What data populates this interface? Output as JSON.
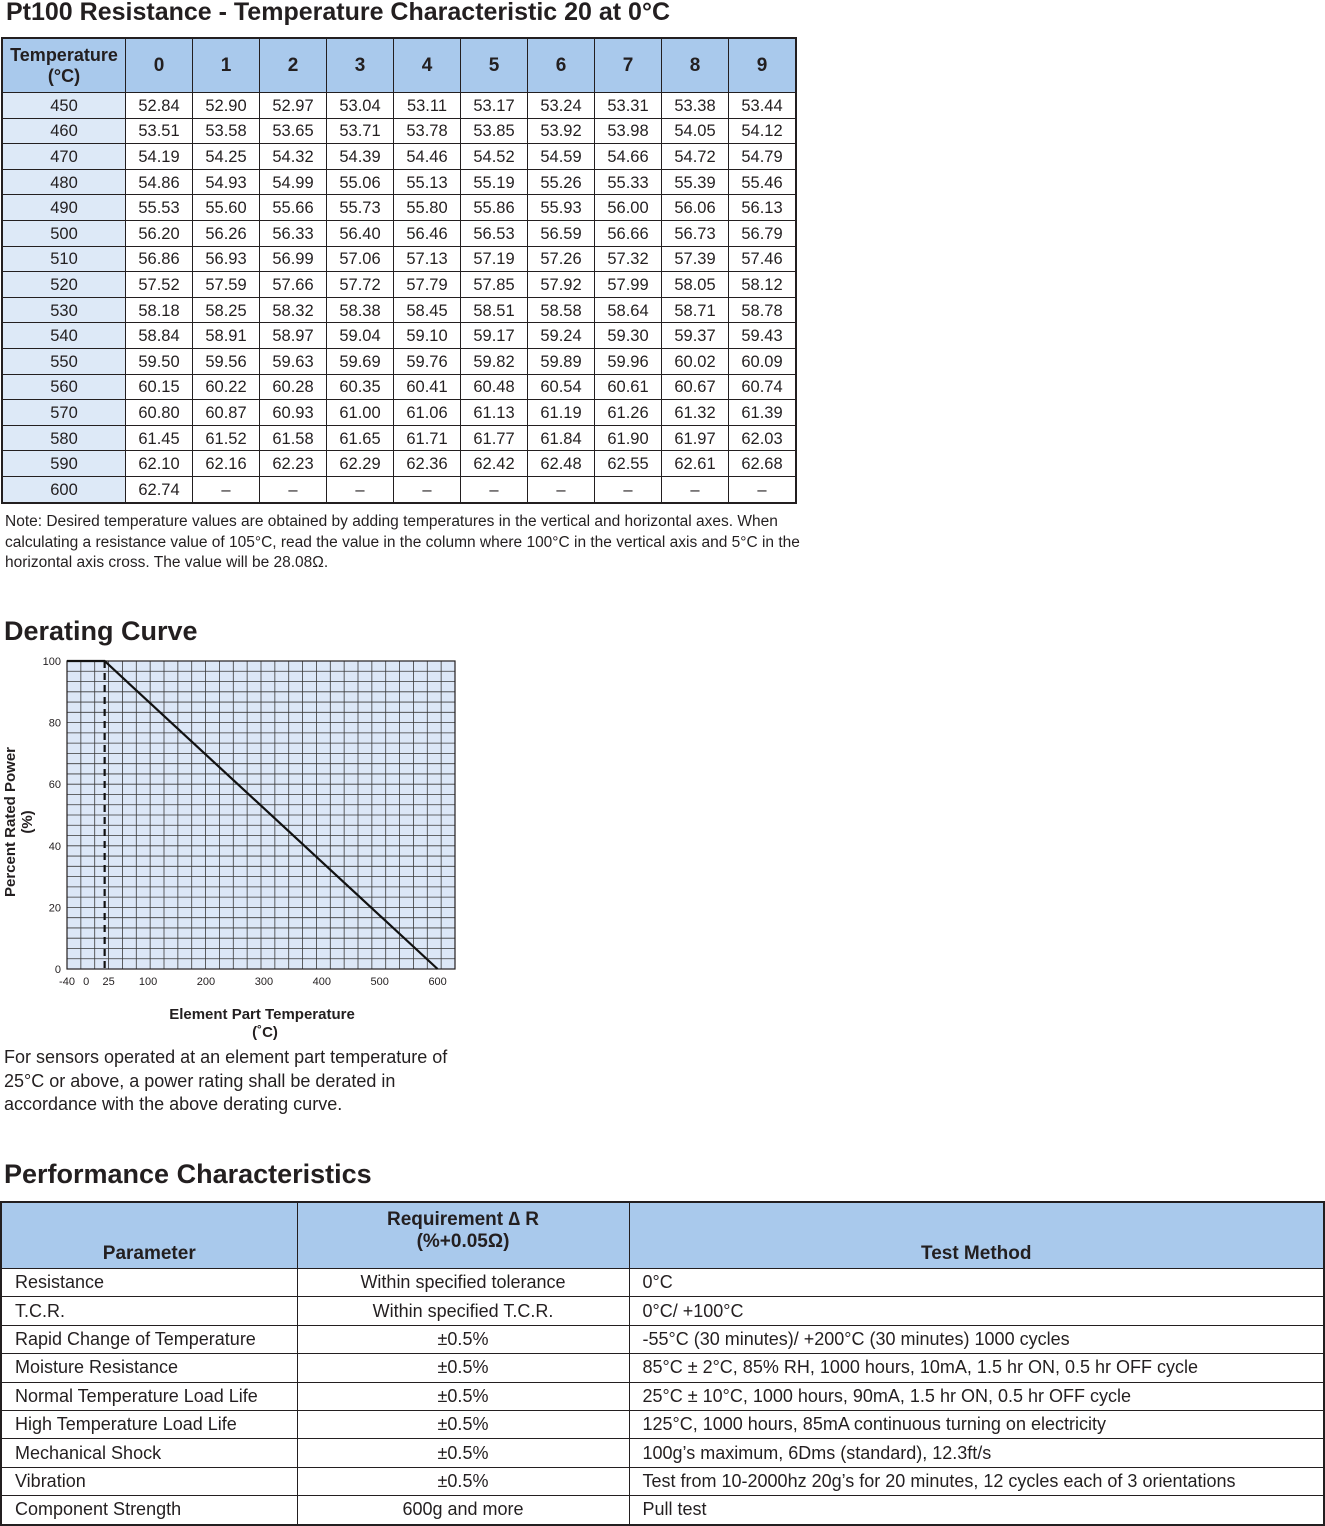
{
  "resistance_table": {
    "title": "Pt100 Resistance - Temperature Characteristic 20 at 0°C",
    "header_first_line1": "Temperature",
    "header_first_line2": "(°C)",
    "columns": [
      "0",
      "1",
      "2",
      "3",
      "4",
      "5",
      "6",
      "7",
      "8",
      "9"
    ],
    "rows": [
      {
        "temp": "450",
        "values": [
          "52.84",
          "52.90",
          "52.97",
          "53.04",
          "53.11",
          "53.17",
          "53.24",
          "53.31",
          "53.38",
          "53.44"
        ]
      },
      {
        "temp": "460",
        "values": [
          "53.51",
          "53.58",
          "53.65",
          "53.71",
          "53.78",
          "53.85",
          "53.92",
          "53.98",
          "54.05",
          "54.12"
        ]
      },
      {
        "temp": "470",
        "values": [
          "54.19",
          "54.25",
          "54.32",
          "54.39",
          "54.46",
          "54.52",
          "54.59",
          "54.66",
          "54.72",
          "54.79"
        ]
      },
      {
        "temp": "480",
        "values": [
          "54.86",
          "54.93",
          "54.99",
          "55.06",
          "55.13",
          "55.19",
          "55.26",
          "55.33",
          "55.39",
          "55.46"
        ]
      },
      {
        "temp": "490",
        "values": [
          "55.53",
          "55.60",
          "55.66",
          "55.73",
          "55.80",
          "55.86",
          "55.93",
          "56.00",
          "56.06",
          "56.13"
        ]
      },
      {
        "temp": "500",
        "values": [
          "56.20",
          "56.26",
          "56.33",
          "56.40",
          "56.46",
          "56.53",
          "56.59",
          "56.66",
          "56.73",
          "56.79"
        ]
      },
      {
        "temp": "510",
        "values": [
          "56.86",
          "56.93",
          "56.99",
          "57.06",
          "57.13",
          "57.19",
          "57.26",
          "57.32",
          "57.39",
          "57.46"
        ]
      },
      {
        "temp": "520",
        "values": [
          "57.52",
          "57.59",
          "57.66",
          "57.72",
          "57.79",
          "57.85",
          "57.92",
          "57.99",
          "58.05",
          "58.12"
        ]
      },
      {
        "temp": "530",
        "values": [
          "58.18",
          "58.25",
          "58.32",
          "58.38",
          "58.45",
          "58.51",
          "58.58",
          "58.64",
          "58.71",
          "58.78"
        ]
      },
      {
        "temp": "540",
        "values": [
          "58.84",
          "58.91",
          "58.97",
          "59.04",
          "59.10",
          "59.17",
          "59.24",
          "59.30",
          "59.37",
          "59.43"
        ]
      },
      {
        "temp": "550",
        "values": [
          "59.50",
          "59.56",
          "59.63",
          "59.69",
          "59.76",
          "59.82",
          "59.89",
          "59.96",
          "60.02",
          "60.09"
        ]
      },
      {
        "temp": "560",
        "values": [
          "60.15",
          "60.22",
          "60.28",
          "60.35",
          "60.41",
          "60.48",
          "60.54",
          "60.61",
          "60.67",
          "60.74"
        ]
      },
      {
        "temp": "570",
        "values": [
          "60.80",
          "60.87",
          "60.93",
          "61.00",
          "61.06",
          "61.13",
          "61.19",
          "61.26",
          "61.32",
          "61.39"
        ]
      },
      {
        "temp": "580",
        "values": [
          "61.45",
          "61.52",
          "61.58",
          "61.65",
          "61.71",
          "61.77",
          "61.84",
          "61.90",
          "61.97",
          "62.03"
        ]
      },
      {
        "temp": "590",
        "values": [
          "62.10",
          "62.16",
          "62.23",
          "62.29",
          "62.36",
          "62.42",
          "62.48",
          "62.55",
          "62.61",
          "62.68"
        ]
      },
      {
        "temp": "600",
        "values": [
          "62.74",
          "–",
          "–",
          "–",
          "–",
          "–",
          "–",
          "–",
          "–",
          "–"
        ]
      }
    ],
    "note": "Note: Desired temperature values are obtained by adding temperatures in the vertical and horizontal axes. When calculating a resistance value of 105°C, read the value in the column where 100°C in the vertical axis and 5°C in the horizontal axis cross. The value will be 28.08Ω."
  },
  "derating": {
    "title": "Derating Curve",
    "description": "For sensors operated at an element part temperature of 25°C or above, a power rating shall be derated in accordance with the above derating curve."
  },
  "chart_data": {
    "type": "line",
    "title": "",
    "xlabel_line1": "Element Part Temperature",
    "xlabel_line2": "(˚C)",
    "ylabel_line1": "Percent Rated Power",
    "ylabel_line2": "(%)",
    "xlim": [
      -40,
      630
    ],
    "ylim": [
      0,
      100
    ],
    "x_ticks": [
      "-40",
      "0",
      "25",
      "100",
      "200",
      "300",
      "400",
      "500",
      "600"
    ],
    "x_tick_values": [
      -40,
      0,
      25,
      100,
      200,
      300,
      400,
      500,
      600
    ],
    "y_ticks": [
      "0",
      "20",
      "40",
      "60",
      "80",
      "100"
    ],
    "y_tick_values": [
      0,
      20,
      40,
      60,
      80,
      100
    ],
    "grid": true,
    "series": [
      {
        "x": [
          -40,
          25,
          600
        ],
        "y": [
          100,
          100,
          0
        ]
      }
    ],
    "reference_line_x": 25,
    "colors": {
      "plot_bg": "#dce7f7",
      "grid": "#3a3a3a",
      "line": "#111111"
    }
  },
  "performance": {
    "title": "Performance Characteristics",
    "headers": {
      "parameter": "Parameter",
      "requirement_line1": "Requirement ∆ R",
      "requirement_line2": "(%+0.05Ω)",
      "method": "Test Method"
    },
    "rows": [
      {
        "parameter": "Resistance",
        "requirement": "Within specified tolerance",
        "method": "0°C"
      },
      {
        "parameter": "T.C.R.",
        "requirement": "Within specified T.C.R.",
        "method": "0°C/ +100°C"
      },
      {
        "parameter": "Rapid Change of Temperature",
        "requirement": "±0.5%",
        "method": "-55°C (30 minutes)/ +200°C (30 minutes) 1000 cycles"
      },
      {
        "parameter": "Moisture Resistance",
        "requirement": "±0.5%",
        "method": "85°C ± 2°C, 85% RH, 1000 hours, 10mA, 1.5 hr ON, 0.5 hr OFF cycle"
      },
      {
        "parameter": "Normal Temperature Load Life",
        "requirement": "±0.5%",
        "method": "25°C ± 10°C, 1000 hours, 90mA, 1.5 hr ON, 0.5 hr OFF cycle"
      },
      {
        "parameter": "High Temperature Load Life",
        "requirement": "±0.5%",
        "method": "125°C, 1000 hours, 85mA continuous turning on electricity"
      },
      {
        "parameter": "Mechanical Shock",
        "requirement": "±0.5%",
        "method": "100g’s maximum, 6Dms (standard), 12.3ft/s"
      },
      {
        "parameter": "Vibration",
        "requirement": "±0.5%",
        "method": "Test from 10-2000hz 20g’s for 20 minutes, 12 cycles each of 3 orientations"
      },
      {
        "parameter": "Component Strength",
        "requirement": "600g and more",
        "method": "Pull test"
      }
    ]
  },
  "colors": {
    "header_blue": "#a9c9ec",
    "row_label_blue": "#dde9f7",
    "text": "#231f20"
  }
}
